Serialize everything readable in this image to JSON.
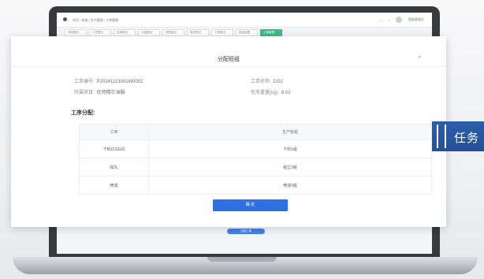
{
  "app": {
    "breadcrumb": "首页 / 系统 / 生产管理 / 工单管理",
    "user": "超级管理员",
    "tabs": [
      "系统首页",
      "人员登记",
      "仓库登记",
      "计量登记",
      "采购登记",
      "库存登记",
      "工单登记",
      "班组设置",
      "工单管理"
    ],
    "bottom_button": "分配工单"
  },
  "modal": {
    "title": "分配班组",
    "close": "×",
    "work_order_label": "工单编号:",
    "work_order_value": "P20241113001W0002",
    "work_name_label": "工单名称:",
    "work_name_value": "CG2",
    "project_label": "所属项目:",
    "project_value": "优特精尔油服",
    "weight_label": "任务重量(kg):",
    "weight_value": "6.02",
    "section_title": "工序分配:",
    "table": {
      "headers": [
        "工序",
        "生产班组"
      ],
      "rows": [
        [
          "下料(CGG3)",
          "下料1组"
        ],
        [
          "焊丸",
          "组立2组"
        ],
        [
          "喷漆",
          "喷漆1组"
        ]
      ]
    },
    "confirm_label": "确 定"
  },
  "badge": {
    "text": "任务"
  },
  "colors": {
    "primary": "#2f6fe4",
    "success": "#22b573",
    "badge": "#2a58a6"
  }
}
